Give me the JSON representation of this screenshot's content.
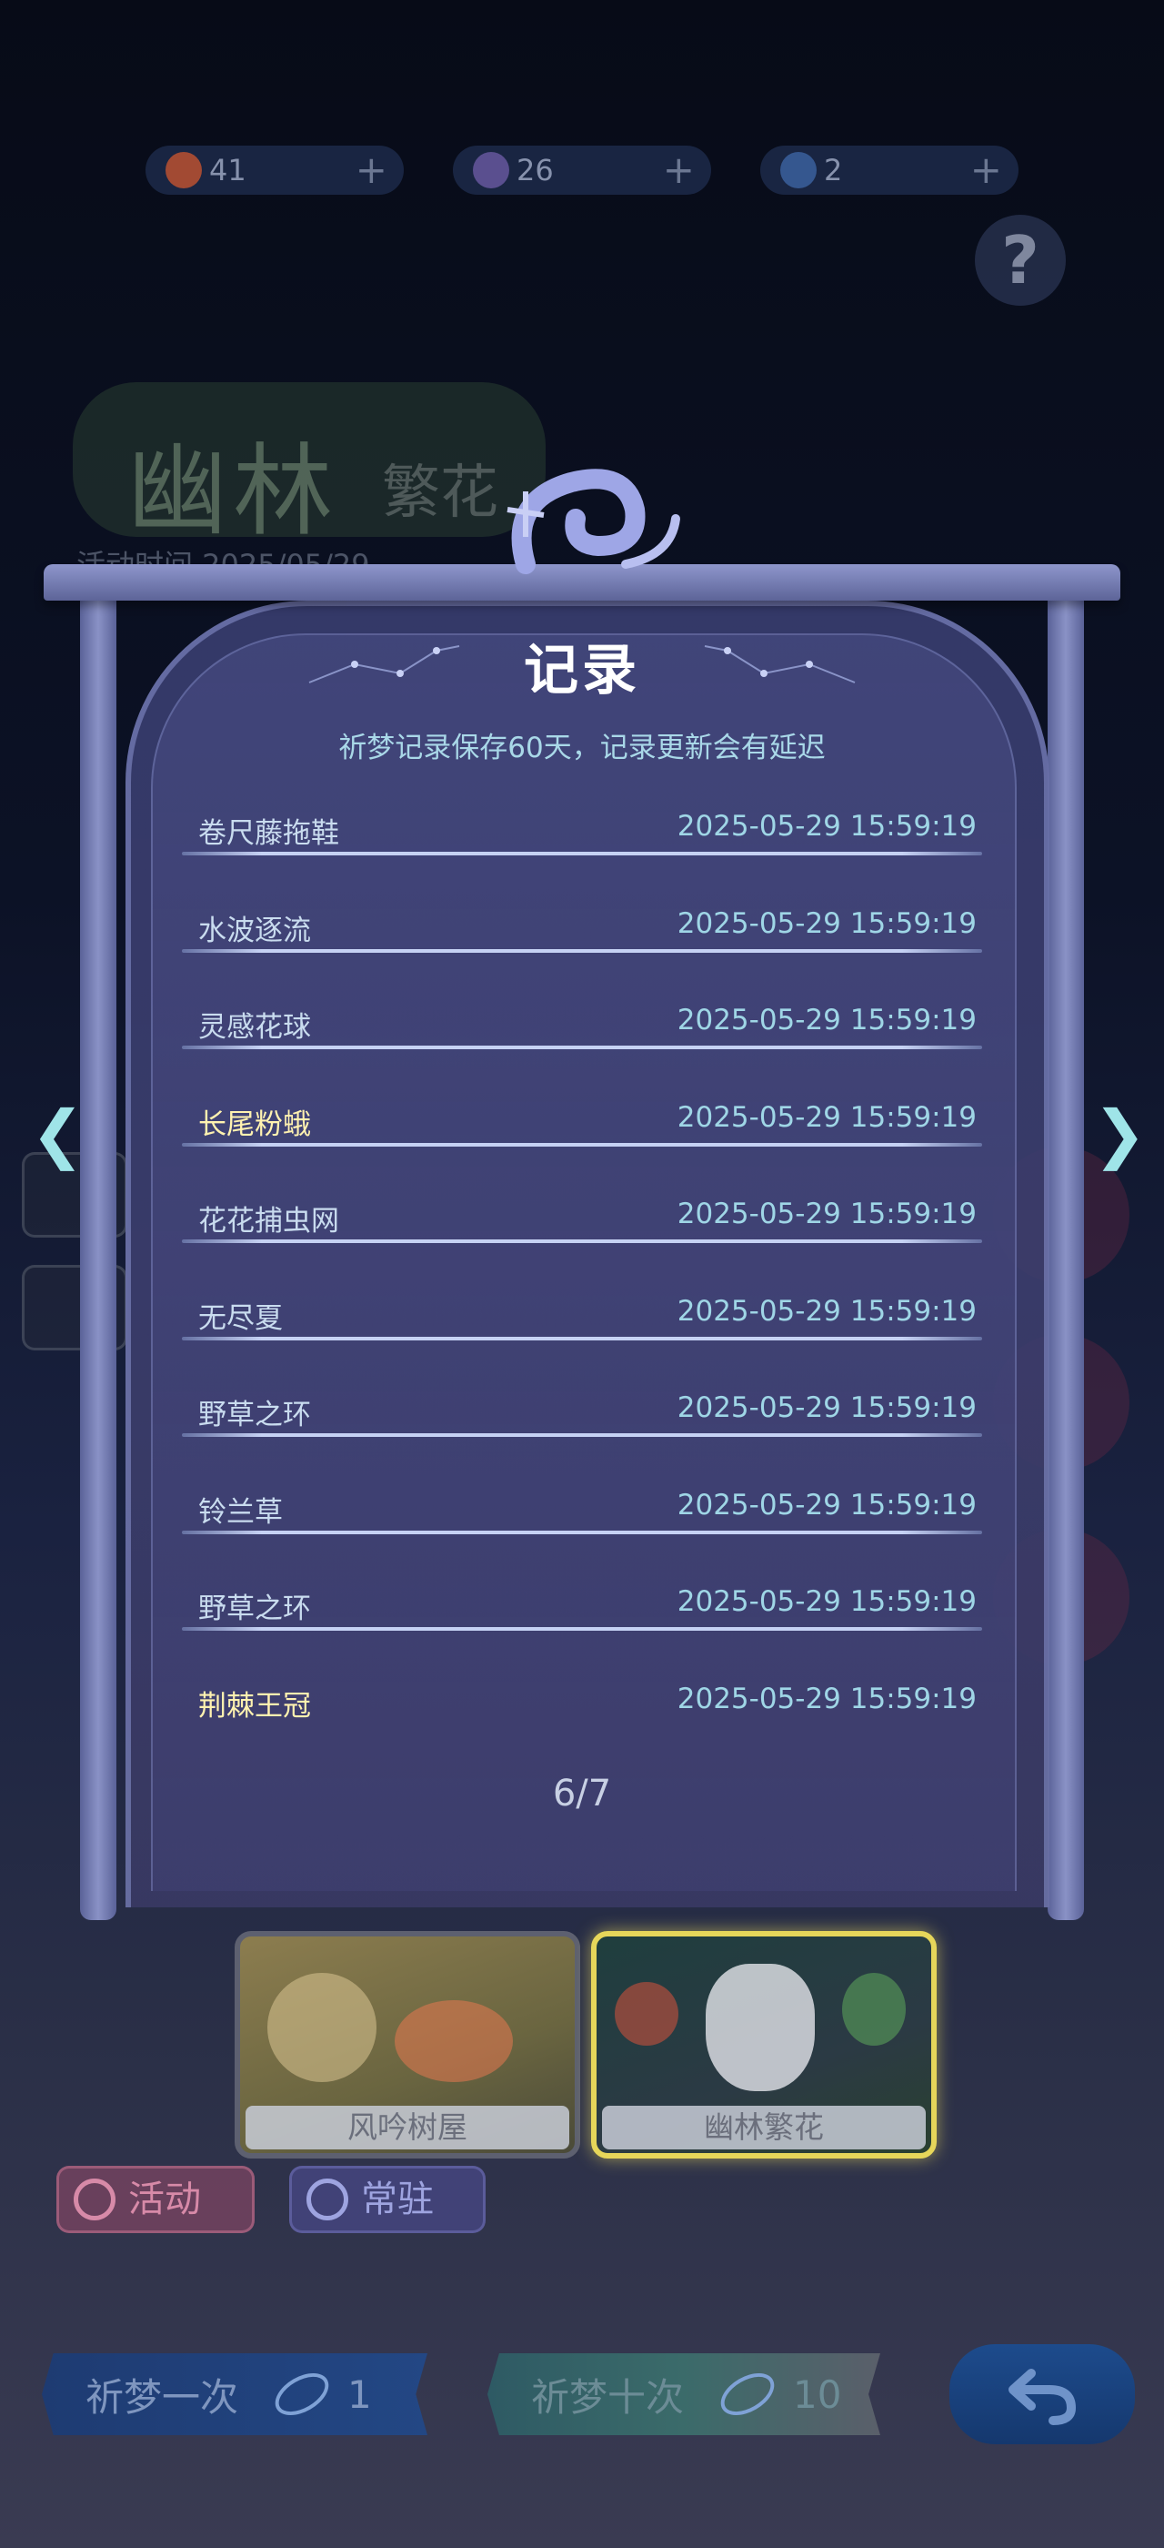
{
  "currencies": [
    {
      "name": "flower-coin",
      "value": "41",
      "color": "#c9552f"
    },
    {
      "name": "moon-coin",
      "value": "26",
      "color": "#7b6fc4"
    },
    {
      "name": "feather-ticket",
      "value": "2",
      "color": "#4a78c2"
    }
  ],
  "background": {
    "event_title": "幽林",
    "event_subtitle": "繁花",
    "event_time": "活动时间 2025/05/29"
  },
  "modal": {
    "title": "记录",
    "subtitle": "祈梦记录保存60天，记录更新会有延迟",
    "records": [
      {
        "name": "卷尺藤拖鞋",
        "time": "2025-05-29 15:59:19",
        "rare": false
      },
      {
        "name": "水波逐流",
        "time": "2025-05-29 15:59:19",
        "rare": false
      },
      {
        "name": "灵感花球",
        "time": "2025-05-29 15:59:19",
        "rare": false
      },
      {
        "name": "长尾粉蛾",
        "time": "2025-05-29 15:59:19",
        "rare": true
      },
      {
        "name": "花花捕虫网",
        "time": "2025-05-29 15:59:19",
        "rare": false
      },
      {
        "name": "无尽夏",
        "time": "2025-05-29 15:59:19",
        "rare": false
      },
      {
        "name": "野草之环",
        "time": "2025-05-29 15:59:19",
        "rare": false
      },
      {
        "name": "铃兰草",
        "time": "2025-05-29 15:59:19",
        "rare": false
      },
      {
        "name": "野草之环",
        "time": "2025-05-29 15:59:19",
        "rare": false
      },
      {
        "name": "荆棘王冠",
        "time": "2025-05-29 15:59:19",
        "rare": true
      }
    ],
    "page_indicator": "6/7"
  },
  "pools": [
    {
      "label": "风吟树屋",
      "selected": false
    },
    {
      "label": "幽林繁花",
      "selected": true
    }
  ],
  "tabs": {
    "activity_label": "活动",
    "permanent_label": "常驻"
  },
  "draw": {
    "once_label": "祈梦一次",
    "once_cost": "1",
    "ten_label": "祈梦十次",
    "ten_cost": "10"
  }
}
